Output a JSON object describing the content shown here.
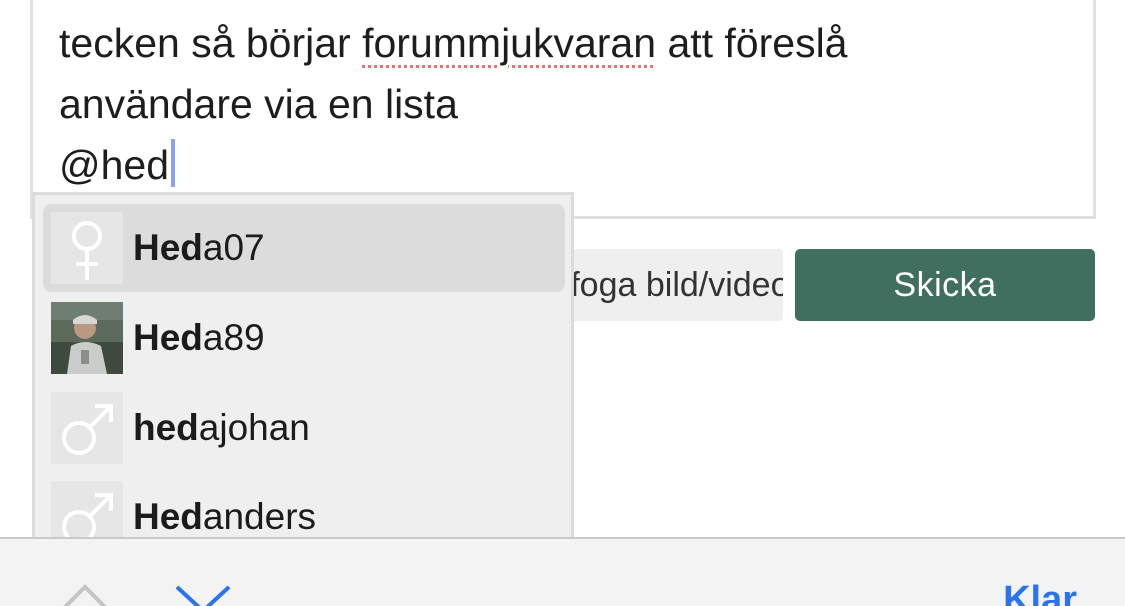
{
  "composer": {
    "line1_before": "tecken så börjar ",
    "line1_misspelled": "forummjukvaran",
    "line1_after": " att föreslå",
    "line2": "användare via en lista",
    "line3": "@hed"
  },
  "actions": {
    "media_label": "Bifoga bild/video",
    "send_label": "Skicka"
  },
  "mention_suggestions": [
    {
      "match": "Hed",
      "rest": "a07",
      "avatar": "female-symbol-icon",
      "selected": true
    },
    {
      "match": "Hed",
      "rest": "a89",
      "avatar": "profile-photo",
      "selected": false
    },
    {
      "match": "hed",
      "rest": "ajohan",
      "avatar": "male-symbol-icon",
      "selected": false
    },
    {
      "match": "Hed",
      "rest": "anders",
      "avatar": "male-symbol-icon",
      "selected": false
    }
  ],
  "keyboard_toolbar": {
    "prev_icon": "chevron-up-icon",
    "next_icon": "chevron-down-icon",
    "done_label": "Klar",
    "accent_color": "#2b74f0"
  },
  "colors": {
    "send_button": "#416f5f",
    "caret": "#8aa3f0"
  }
}
